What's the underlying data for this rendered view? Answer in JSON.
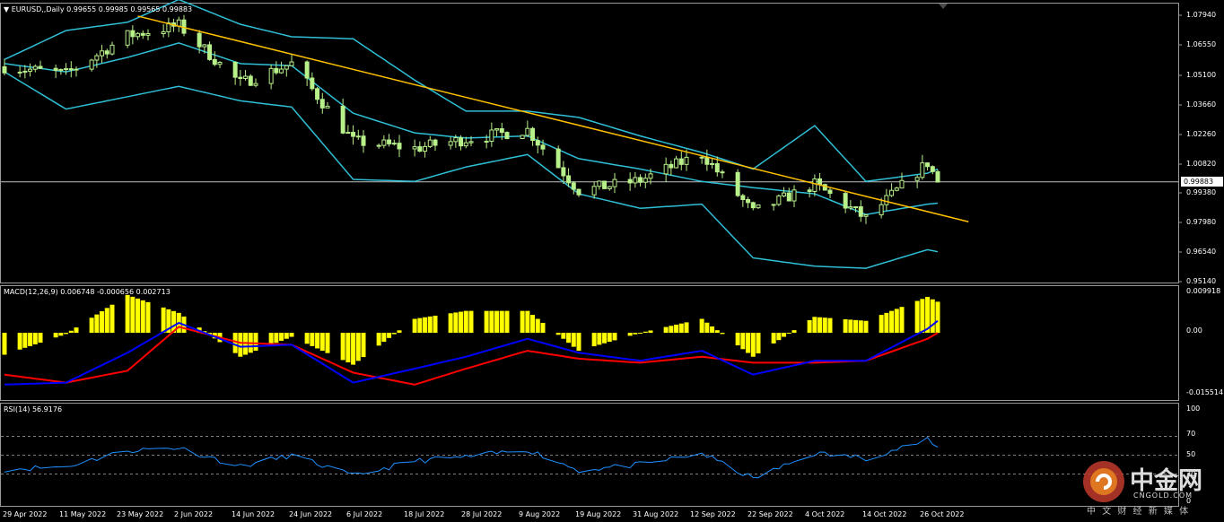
{
  "main": {
    "header_arrow": "▼",
    "header": "EURUSD,,Daily  0.99655 0.99985 0.99565 0.99883",
    "yticks": [
      "1.07940",
      "1.06550",
      "1.05100",
      "1.03660",
      "1.02260",
      "1.00820",
      "0.99380",
      "0.97980",
      "0.96540",
      "0.95140"
    ],
    "current_price": "0.99883"
  },
  "macd": {
    "header": "MACD(12,26,9) 0.006748 -0.000656 0.002713",
    "yticks": [
      "0.009918",
      "0.00",
      "-0.015514"
    ]
  },
  "rsi": {
    "header": "RSI(14) 56.9176",
    "yticks": [
      "100",
      "70",
      "50",
      "30",
      "0"
    ]
  },
  "xticks": [
    "29 Apr 2022",
    "11 May 2022",
    "23 May 2022",
    "2 Jun 2022",
    "14 Jun 2022",
    "24 Jun 2022",
    "6 Jul 2022",
    "18 Jul 2022",
    "28 Jul 2022",
    "9 Aug 2022",
    "19 Aug 2022",
    "31 Aug 2022",
    "12 Sep 2022",
    "22 Sep 2022",
    "4 Oct 2022",
    "14 Oct 2022",
    "26 Oct 2022"
  ],
  "watermark": {
    "brand": "中金网",
    "domain": "CNGOLD.COM",
    "tagline": "中 文 财 经 新 媒 体"
  },
  "colors": {
    "background": "#000000",
    "candles": "#b8f08a",
    "bollinger": "#2fbfd6",
    "trendline": "#ffc000",
    "macd_hist": "#ffff00",
    "macd_line": "#0000ff",
    "signal_line": "#ff0000",
    "rsi_line": "#1e90ff",
    "grid": "#808080"
  },
  "chart_data": [
    {
      "type": "candlestick",
      "title": "EURUSD,Daily",
      "ylim": [
        0.9514,
        1.0794
      ],
      "x": [
        "2022-04-29",
        "2022-05-11",
        "2022-05-23",
        "2022-06-02",
        "2022-06-14",
        "2022-06-24",
        "2022-07-06",
        "2022-07-18",
        "2022-07-28",
        "2022-08-09",
        "2022-08-19",
        "2022-08-31",
        "2022-09-12",
        "2022-09-22",
        "2022-10-04",
        "2022-10-14",
        "2022-10-26",
        "2022-10-28"
      ],
      "close": [
        1.0545,
        1.051,
        1.0695,
        1.0745,
        1.0465,
        1.056,
        1.0185,
        1.015,
        1.0195,
        1.024,
        0.9945,
        0.9995,
        1.0125,
        0.984,
        0.9975,
        0.981,
        1.008,
        0.9988
      ],
      "bollinger_upper": [
        1.058,
        1.072,
        1.076,
        1.087,
        1.075,
        1.069,
        1.068,
        1.048,
        1.033,
        1.033,
        1.03,
        1.021,
        1.013,
        1.005,
        1.026,
        0.999,
        1.003,
        1.005
      ],
      "bollinger_middle": [
        1.056,
        1.052,
        1.059,
        1.066,
        1.056,
        1.055,
        1.032,
        1.0225,
        1.02,
        1.021,
        1.01,
        1.005,
        0.999,
        0.996,
        0.993,
        0.983,
        0.988,
        0.9885
      ],
      "bollinger_lower": [
        1.052,
        1.034,
        1.04,
        1.045,
        1.038,
        1.035,
        1.0,
        0.999,
        1.006,
        1.012,
        0.993,
        0.986,
        0.988,
        0.962,
        0.958,
        0.957,
        0.966,
        0.965
      ],
      "trendline": {
        "from": [
          "2022-05-25",
          1.079
        ],
        "to": [
          "2022-11-03",
          0.9795
        ]
      },
      "current_price": 0.99883
    },
    {
      "type": "bar",
      "title": "MACD(12,26,9)",
      "ylim": [
        -0.015514,
        0.009918
      ],
      "x": [
        "2022-04-29",
        "2022-05-11",
        "2022-05-23",
        "2022-06-02",
        "2022-06-14",
        "2022-06-24",
        "2022-07-06",
        "2022-07-18",
        "2022-07-28",
        "2022-08-09",
        "2022-08-19",
        "2022-08-31",
        "2022-09-12",
        "2022-09-22",
        "2022-10-04",
        "2022-10-14",
        "2022-10-26",
        "2022-10-28"
      ],
      "series": [
        {
          "name": "0.006748",
          "values": [
            -0.0055,
            -0.0003,
            0.0095,
            0.005,
            -0.006,
            -0.001,
            -0.008,
            0.0035,
            0.0055,
            0.0055,
            -0.0045,
            0.0,
            0.0035,
            -0.006,
            0.004,
            0.003,
            0.009,
            0.0078
          ]
        },
        {
          "name": "-0.000656",
          "values": [
            -0.013,
            -0.0125,
            -0.005,
            0.0025,
            -0.0035,
            -0.003,
            -0.0125,
            -0.009,
            -0.006,
            -0.0015,
            -0.005,
            -0.007,
            -0.0045,
            -0.0105,
            -0.007,
            -0.007,
            0.001,
            0.003
          ]
        },
        {
          "name": "0.002713",
          "values": [
            -0.0105,
            -0.0125,
            -0.0095,
            0.0015,
            -0.0025,
            -0.003,
            -0.01,
            -0.013,
            -0.009,
            -0.0045,
            -0.0065,
            -0.0075,
            -0.006,
            -0.0075,
            -0.0075,
            -0.007,
            -0.0015,
            0.0
          ]
        }
      ]
    },
    {
      "type": "line",
      "title": "RSI(14)",
      "ylim": [
        0,
        100
      ],
      "x": [
        "2022-04-29",
        "2022-05-11",
        "2022-05-23",
        "2022-06-02",
        "2022-06-14",
        "2022-06-24",
        "2022-07-06",
        "2022-07-18",
        "2022-07-28",
        "2022-08-09",
        "2022-08-19",
        "2022-08-31",
        "2022-09-12",
        "2022-09-22",
        "2022-10-04",
        "2022-10-14",
        "2022-10-26",
        "2022-10-28"
      ],
      "series": [
        {
          "name": "RSI(14) 56.9176",
          "values": [
            35,
            38,
            55,
            58,
            38,
            50,
            28,
            44,
            48,
            56,
            34,
            40,
            52,
            25,
            52,
            47,
            66,
            57
          ]
        }
      ],
      "levels": [
        70,
        50,
        30
      ]
    }
  ]
}
